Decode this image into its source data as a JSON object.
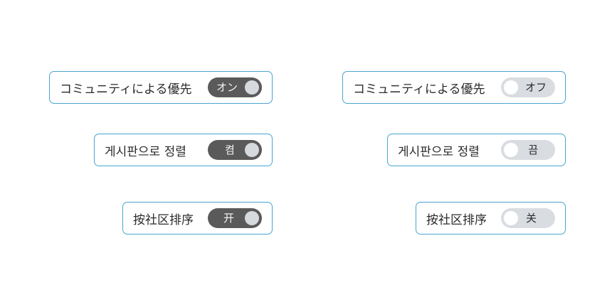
{
  "rows": [
    {
      "on": {
        "label": "コミュニティによる優先",
        "state": "オン"
      },
      "off": {
        "label": "コミュニティによる優先",
        "state": "オフ"
      }
    },
    {
      "on": {
        "label": "게시판으로 정렬",
        "state": "켬"
      },
      "off": {
        "label": "게시판으로 정렬",
        "state": "끔"
      }
    },
    {
      "on": {
        "label": "按社区排序",
        "state": "开"
      },
      "off": {
        "label": "按社区排序",
        "state": "关"
      }
    }
  ],
  "colors": {
    "border": "#4aa3d1",
    "toggle_on": "#5a5a5a",
    "toggle_off": "#d9dde2",
    "knob_on": "#d6d9de",
    "knob_off": "#ffffff"
  }
}
